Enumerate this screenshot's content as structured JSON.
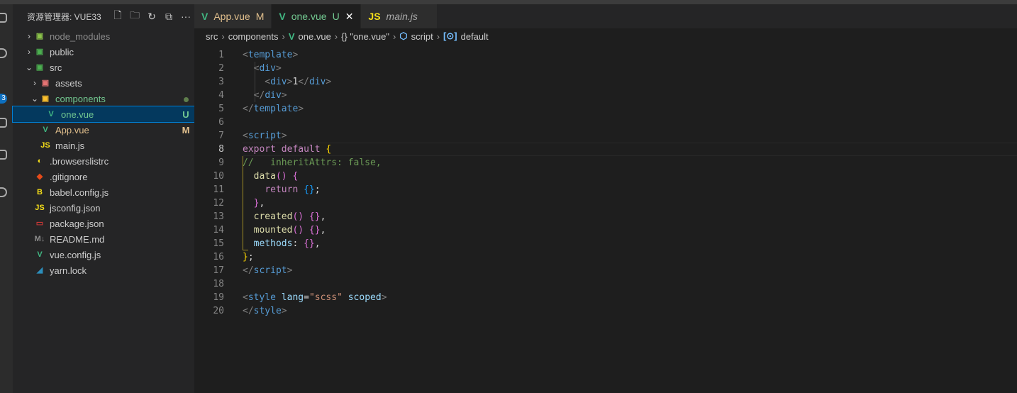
{
  "explorer": {
    "title": "资源管理器: VUE33",
    "actions": [
      "new-file-icon",
      "new-folder-icon",
      "refresh-icon",
      "collapse-all-icon",
      "more-icon"
    ],
    "more": "···",
    "items": [
      {
        "label": "node_modules",
        "indent": 0,
        "chevron": "›",
        "icon": "▣",
        "iconColor": "#8bc34a",
        "labelColor": "#8c8c8c"
      },
      {
        "label": "public",
        "indent": 0,
        "chevron": "›",
        "icon": "▣",
        "iconColor": "#4caf50"
      },
      {
        "label": "src",
        "indent": 0,
        "chevron": "⌄",
        "icon": "▣",
        "iconColor": "#4caf50"
      },
      {
        "label": "assets",
        "indent": 1,
        "chevron": "›",
        "icon": "▣",
        "iconColor": "#e57373"
      },
      {
        "label": "components",
        "indent": 1,
        "chevron": "⌄",
        "icon": "▣",
        "iconColor": "#fbc02d",
        "labelColor": "#73c991",
        "status": "dot"
      },
      {
        "label": "one.vue",
        "indent": 2,
        "icon": "V",
        "iconColor": "#41b883",
        "labelColor": "#73c991",
        "status": "U",
        "statusColor": "#73c991",
        "selected": true
      },
      {
        "label": "App.vue",
        "indent": 1,
        "icon": "V",
        "iconColor": "#41b883",
        "labelColor": "#e2c08d",
        "status": "M",
        "statusColor": "#e2c08d"
      },
      {
        "label": "main.js",
        "indent": 1,
        "icon": "JS",
        "iconColor": "#f5de19"
      },
      {
        "label": ".browserslistrc",
        "indent": 0,
        "icon": "◐",
        "iconColor": "#f5de19"
      },
      {
        "label": ".gitignore",
        "indent": 0,
        "icon": "◆",
        "iconColor": "#e64a19"
      },
      {
        "label": "babel.config.js",
        "indent": 0,
        "icon": "B",
        "iconColor": "#f5de19"
      },
      {
        "label": "jsconfig.json",
        "indent": 0,
        "icon": "JS",
        "iconColor": "#f5de19"
      },
      {
        "label": "package.json",
        "indent": 0,
        "icon": "▭",
        "iconColor": "#cb3837"
      },
      {
        "label": "README.md",
        "indent": 0,
        "icon": "M↓",
        "iconColor": "#8c8c8c"
      },
      {
        "label": "vue.config.js",
        "indent": 0,
        "icon": "V",
        "iconColor": "#41b883"
      },
      {
        "label": "yarn.lock",
        "indent": 0,
        "icon": "◢",
        "iconColor": "#2c8ebb"
      }
    ]
  },
  "activity": {
    "badge": "3"
  },
  "tabs": [
    {
      "label": "App.vue",
      "icon": "V",
      "iconColor": "#41b883",
      "status": "M",
      "color": "#e2c08d"
    },
    {
      "label": "one.vue",
      "icon": "V",
      "iconColor": "#41b883",
      "status": "U",
      "color": "#73c991",
      "active": true,
      "close": "✕"
    },
    {
      "label": "main.js",
      "icon": "JS",
      "iconColor": "#f5de19",
      "color": "#aaa",
      "italic": true
    }
  ],
  "breadcrumb": [
    "src",
    "components",
    "one.vue",
    "{} \"one.vue\"",
    "script",
    "default"
  ],
  "code": {
    "current_line": 8,
    "lines": [
      [
        [
          "<",
          "t"
        ],
        [
          "template",
          "g"
        ],
        [
          ">",
          "t"
        ]
      ],
      [
        [
          "  <",
          "t"
        ],
        [
          "div",
          "g"
        ],
        [
          ">",
          "t"
        ]
      ],
      [
        [
          "    <",
          "t"
        ],
        [
          "div",
          "g"
        ],
        [
          ">",
          "t"
        ],
        [
          "1",
          "w"
        ],
        [
          "</",
          "t"
        ],
        [
          "div",
          "g"
        ],
        [
          ">",
          "t"
        ]
      ],
      [
        [
          "  </",
          "t"
        ],
        [
          "div",
          "g"
        ],
        [
          ">",
          "t"
        ]
      ],
      [
        [
          "</",
          "t"
        ],
        [
          "template",
          "g"
        ],
        [
          ">",
          "t"
        ]
      ],
      [],
      [
        [
          "<",
          "t"
        ],
        [
          "script",
          "g"
        ],
        [
          ">",
          "t"
        ]
      ],
      [
        [
          "export default ",
          "k"
        ],
        [
          "{",
          "y"
        ]
      ],
      [
        [
          "//   inheritAttrs: false,",
          "c"
        ]
      ],
      [
        [
          "  ",
          "w"
        ],
        [
          "data",
          "f"
        ],
        [
          "() {",
          "p"
        ]
      ],
      [
        [
          "    ",
          "w"
        ],
        [
          "return ",
          "k"
        ],
        [
          "{}",
          "b"
        ],
        [
          ";",
          "w"
        ]
      ],
      [
        [
          "  }",
          "p"
        ],
        [
          ",",
          "w"
        ]
      ],
      [
        [
          "  ",
          "w"
        ],
        [
          "created",
          "f"
        ],
        [
          "() {}",
          "p"
        ],
        [
          ",",
          "w"
        ]
      ],
      [
        [
          "  ",
          "w"
        ],
        [
          "mounted",
          "f"
        ],
        [
          "() {}",
          "p"
        ],
        [
          ",",
          "w"
        ]
      ],
      [
        [
          "  ",
          "w"
        ],
        [
          "methods",
          "v"
        ],
        [
          ": ",
          "w"
        ],
        [
          "{}",
          "p"
        ],
        [
          ",",
          "w"
        ]
      ],
      [
        [
          "}",
          "y"
        ],
        [
          ";",
          "w"
        ]
      ],
      [
        [
          "</",
          "t"
        ],
        [
          "script",
          "g"
        ],
        [
          ">",
          "t"
        ]
      ],
      [],
      [
        [
          "<",
          "t"
        ],
        [
          "style ",
          "g"
        ],
        [
          "lang",
          "v"
        ],
        [
          "=",
          "w"
        ],
        [
          "\"scss\"",
          "s"
        ],
        [
          " scoped",
          "v"
        ],
        [
          ">",
          "t"
        ]
      ],
      [
        [
          "</",
          "t"
        ],
        [
          "style",
          "g"
        ],
        [
          ">",
          "t"
        ]
      ]
    ]
  }
}
